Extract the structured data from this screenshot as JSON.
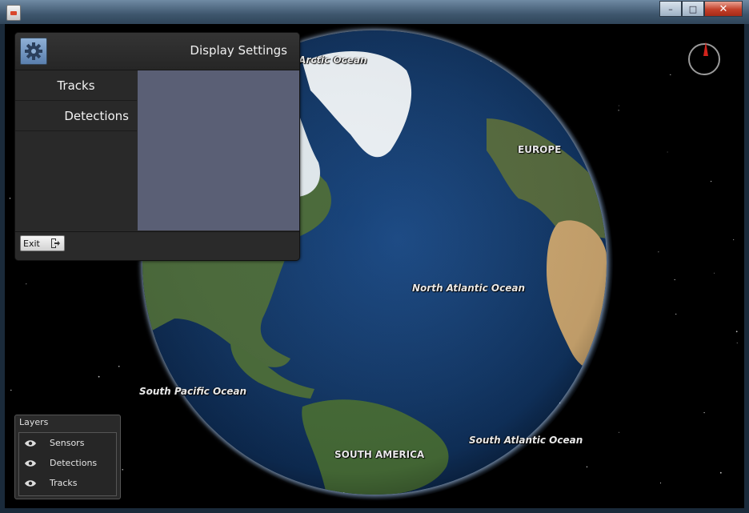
{
  "window": {
    "title": "",
    "controls": {
      "minimize": "–",
      "maximize": "□",
      "close": "✕"
    }
  },
  "map": {
    "labels": {
      "arctic_ocean": "Arctic Ocean",
      "europe": "EUROPE",
      "north_atlantic": "North Atlantic Ocean",
      "south_pacific": "South Pacific Ocean",
      "south_atlantic": "South Atlantic Ocean",
      "south_america": "SOUTH AMERICA"
    },
    "colors": {
      "ocean": "#123766",
      "land": "#4a6a3a",
      "ice": "#e8eef2",
      "desert": "#c9a46e"
    }
  },
  "compass": {
    "needle_color": "#d2231b",
    "icon": "compass-icon"
  },
  "settings_panel": {
    "title": "Display Settings",
    "gear_icon": "gear-icon",
    "menu": [
      {
        "label": "Tracks"
      },
      {
        "label": "Detections"
      }
    ],
    "exit_label": "Exit"
  },
  "layers_panel": {
    "title": "Layers",
    "items": [
      {
        "label": "Sensors",
        "icon": "eye-icon"
      },
      {
        "label": "Detections",
        "icon": "eye-icon"
      },
      {
        "label": "Tracks",
        "icon": "eye-icon"
      }
    ]
  }
}
